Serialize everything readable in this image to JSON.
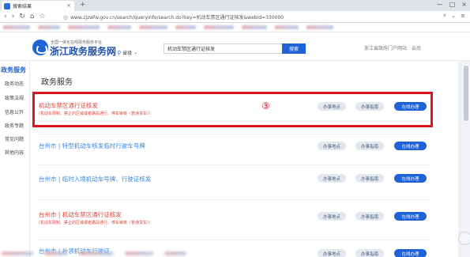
{
  "browser": {
    "tab_title": "搜索结果",
    "tab_close": "×",
    "new_tab": "+",
    "url": "www.zjzwfw.gov.cn/search/queryinfo/search.do?key=机动车禁区通行证核发&webId=330000",
    "nav": {
      "back": "‹",
      "forward": "›",
      "reload": "↻",
      "home": "⌂",
      "star": "☆"
    },
    "right_icons": [
      "⚡",
      "⌄",
      "≡"
    ],
    "window": {
      "min": "—",
      "max": "□",
      "close": "×"
    }
  },
  "site": {
    "subtitle": "全国一体化在线政务服务平台",
    "title": "浙江政务服务网",
    "location": "省级",
    "location_caret": "⌄",
    "search_value": "机动车禁区通行证核发",
    "search_button": "搜索",
    "top_right": [
      "浙江省政府门户网站",
      "云尚"
    ]
  },
  "sidebar": {
    "heading": "政务服务",
    "items": [
      "政务动态",
      "政策法规",
      "信息公开",
      "政务专题",
      "常见问题",
      "其他内容"
    ]
  },
  "main": {
    "title": "政务服务",
    "annotation": "③",
    "results": [
      {
        "title": "机动车禁区通行证核发",
        "subtitle": "(机动车限制、禁止的区域或者路段通行、停车审核（普通货车））",
        "buttons": [
          "办事地点",
          "办事指南",
          "在线办理"
        ],
        "title_color": "#e2453c"
      },
      {
        "title": "台州市 | 特型机动车核发临时行驶车号牌",
        "subtitle": "",
        "buttons": [
          "办事地点",
          "办事指南",
          "在线办理"
        ],
        "title_color": "#3a86e0"
      },
      {
        "title": "台州市 | 临时入境机动车号牌、行驶证核发",
        "subtitle": "",
        "buttons": [
          "办事地点",
          "办事指南",
          "在线办理"
        ],
        "title_color": "#3a86e0"
      },
      {
        "title": "台州市 | 机动车禁区通行证核发",
        "subtitle": "(机动车限制、禁止的区域或者路段通行、停车审核（普通货车））",
        "buttons": [
          "办事地点",
          "办事指南",
          "在线办理"
        ],
        "title_color": "#e2453c"
      },
      {
        "title": "台州市 | 补领机动车行驶证",
        "subtitle": "",
        "buttons": [
          "办事地点",
          "办事指南",
          "在线办理"
        ],
        "title_color": "#3a86e0"
      }
    ]
  },
  "colors": {
    "accent": "#1f63d6",
    "highlight": "#e0141c",
    "link": "#3a86e0",
    "keyword": "#e2453c"
  }
}
